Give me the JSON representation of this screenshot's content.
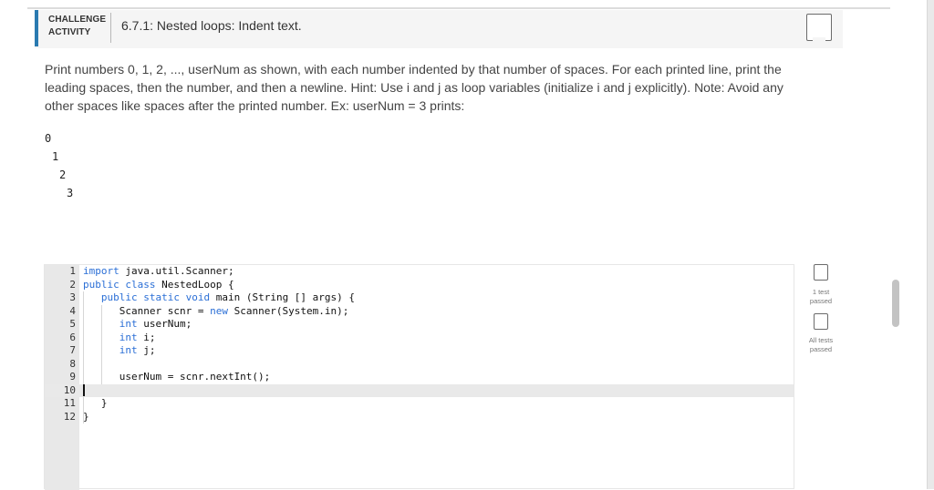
{
  "header": {
    "activity_label": "CHALLENGE ACTIVITY",
    "title": "6.7.1: Nested loops: Indent text."
  },
  "prompt": "Print numbers 0, 1, 2, ..., userNum as shown, with each number indented by that number of spaces. For each printed line, print the leading spaces, then the number, and then a newline. Hint: Use i and j as loop variables (initialize i and j explicitly). Note: Avoid any other spaces like spaces after the printed number. Ex: userNum = 3 prints:",
  "example_output": [
    "0",
    "1",
    "2",
    "3"
  ],
  "code_lines": [
    {
      "n": "1",
      "text": "import java.util.Scanner;"
    },
    {
      "n": "2",
      "text": "public class NestedLoop {"
    },
    {
      "n": "3",
      "text": "   public static void main (String [] args) {"
    },
    {
      "n": "4",
      "text": "      Scanner scnr = new Scanner(System.in);"
    },
    {
      "n": "5",
      "text": "      int userNum;"
    },
    {
      "n": "6",
      "text": "      int i;"
    },
    {
      "n": "7",
      "text": "      int j;"
    },
    {
      "n": "8",
      "text": ""
    },
    {
      "n": "9",
      "text": "      userNum = scnr.nextInt();"
    },
    {
      "n": "10",
      "text": ""
    },
    {
      "n": "11",
      "text": "   }"
    },
    {
      "n": "12",
      "text": "}"
    }
  ],
  "tests": {
    "one_label": "1 test passed",
    "all_label": "All tests passed"
  },
  "colors": {
    "accent": "#2a7ab0",
    "keyword": "#2b6fd6",
    "gutter": "#e8e8e8"
  }
}
